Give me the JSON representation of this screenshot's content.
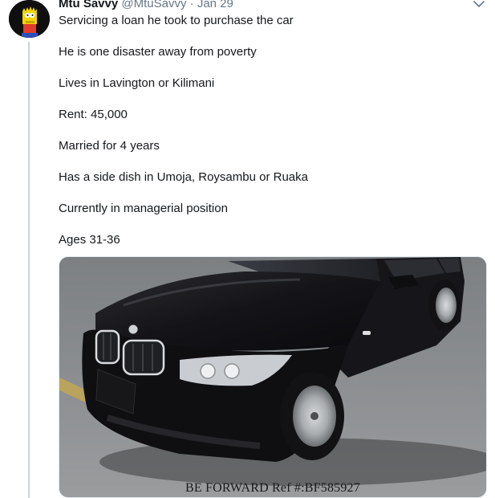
{
  "tweet": {
    "author_name": "Mtu Savvy",
    "author_handle": "@MtuSavvy",
    "separator": "·",
    "date": "Jan 29",
    "lines": [
      "Servicing a loan he took to purchase the car",
      "He is one disaster away from poverty",
      "Lives in Lavington or Kilimani",
      "Rent: 45,000",
      "Married for 4 years",
      "Has a side dish in Umoja, Roysambu or Ruaka",
      "Currently in managerial position",
      "Ages 31-36"
    ],
    "media": {
      "watermark": "BE FORWARD Ref #:BF585927"
    }
  },
  "icons": {
    "menu": "chevron-down-icon",
    "avatar": "cartoon-avatar"
  },
  "colors": {
    "text": "#14171a",
    "muted": "#657786",
    "thread_line": "#ccd6dd",
    "avatar_bg": "#0f0f0f",
    "car_body": "#121216"
  }
}
